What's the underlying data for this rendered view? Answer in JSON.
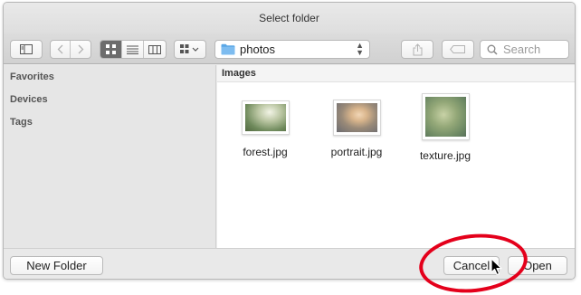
{
  "window": {
    "title": "Select folder"
  },
  "toolbar": {
    "location": "photos",
    "search_placeholder": "Search"
  },
  "sidebar": {
    "sections": [
      {
        "label": "Favorites"
      },
      {
        "label": "Devices"
      },
      {
        "label": "Tags"
      }
    ]
  },
  "main": {
    "column_header": "Images",
    "files": [
      {
        "name": "forest.jpg"
      },
      {
        "name": "portrait.jpg"
      },
      {
        "name": "texture.jpg"
      }
    ]
  },
  "footer": {
    "new_folder_label": "New Folder",
    "cancel_label": "Cancel",
    "open_label": "Open"
  },
  "colors": {
    "highlight_ring": "#e4001b",
    "folder_blue": "#5aa7e6",
    "active_view": "#6c6c6c"
  },
  "icons": [
    "sidebar-toggle-icon",
    "back-icon",
    "forward-icon",
    "icon-view-icon",
    "list-view-icon",
    "column-view-icon",
    "arrange-icon",
    "folder-icon",
    "share-icon",
    "tag-icon",
    "search-icon",
    "cursor-icon"
  ]
}
